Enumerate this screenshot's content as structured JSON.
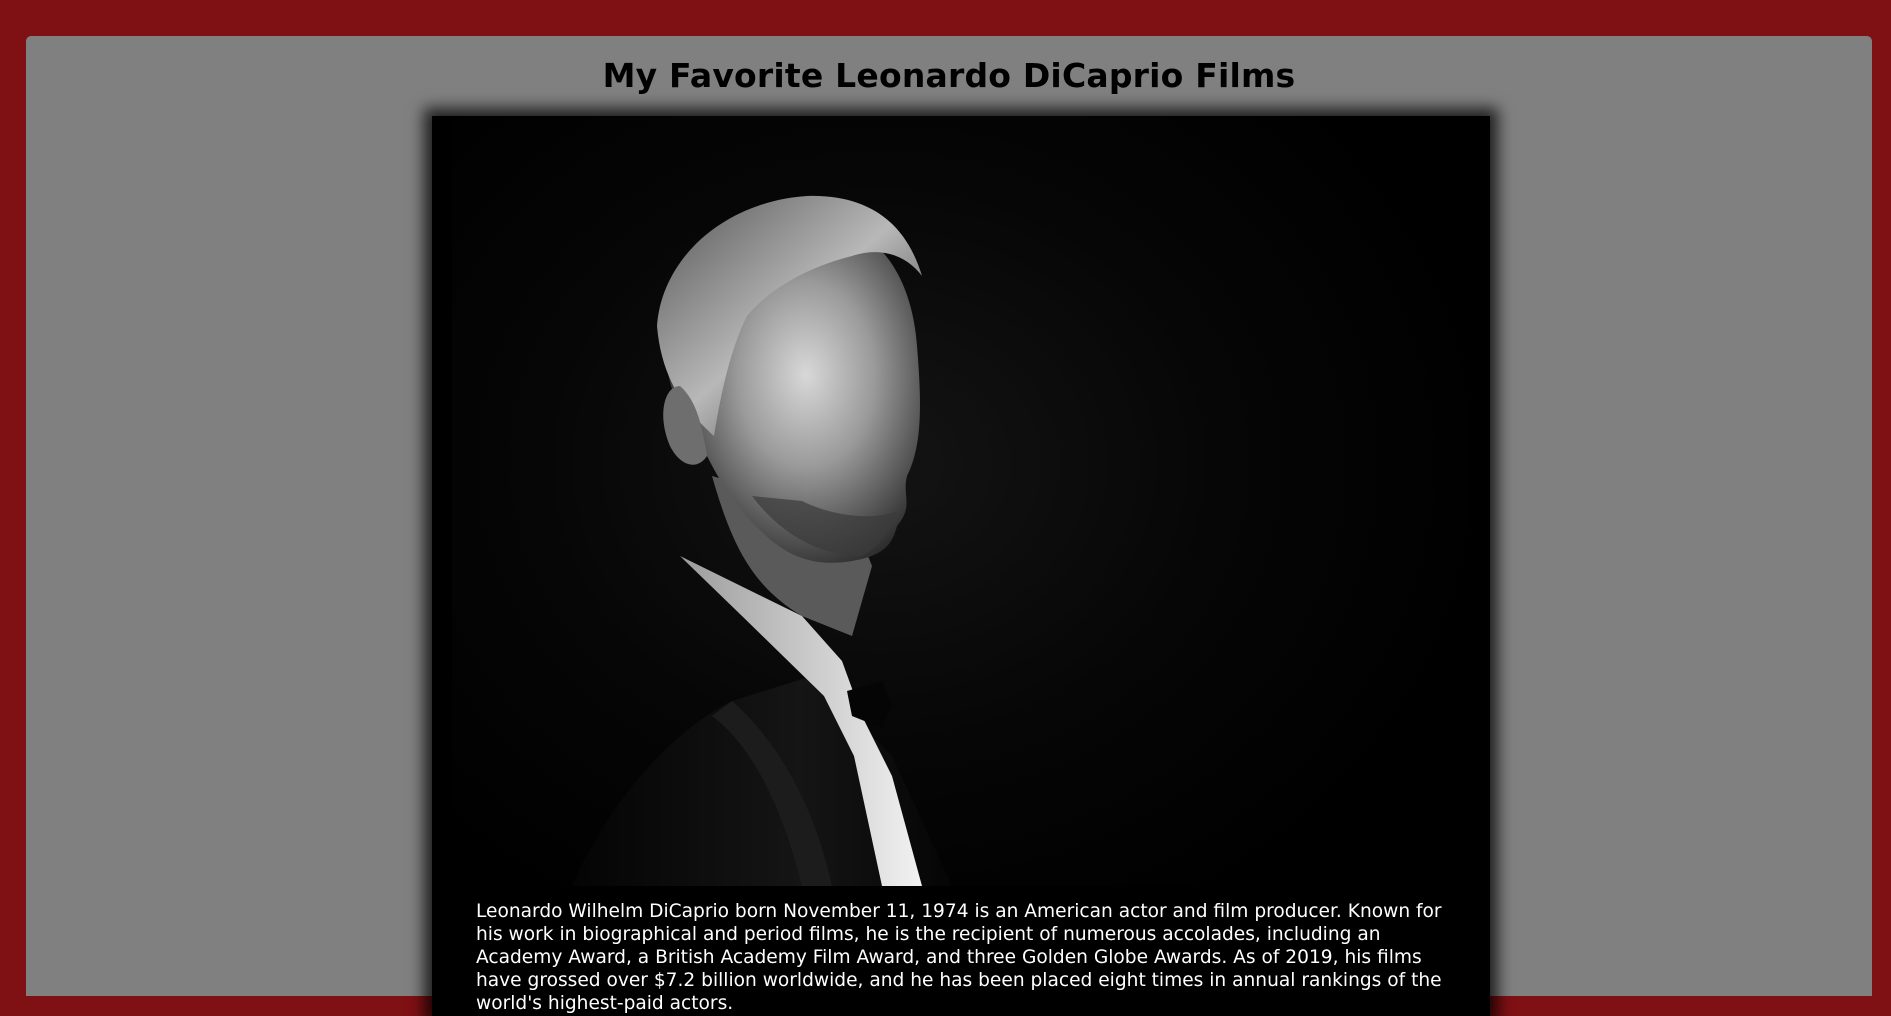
{
  "page": {
    "title": "My Favorite Leonardo DiCaprio Films"
  },
  "hero": {
    "image_subject": "black-and-white profile portrait of Leonardo DiCaprio in a tuxedo",
    "bio": "Leonardo Wilhelm DiCaprio born November 11, 1974 is an American actor and film producer. Known for his work in biographical and period films, he is the recipient of numerous accolades, including an Academy Award, a British Academy Film Award, and three Golden Globe Awards. As of 2019, his films have grossed over $7.2 billion worldwide, and he has been placed eight times in annual rankings of the world's highest-paid actors."
  },
  "colors": {
    "frame": "#7f1014",
    "panel": "#808080",
    "card": "#000000",
    "text_light": "#ffffff",
    "text_dark": "#000000"
  }
}
